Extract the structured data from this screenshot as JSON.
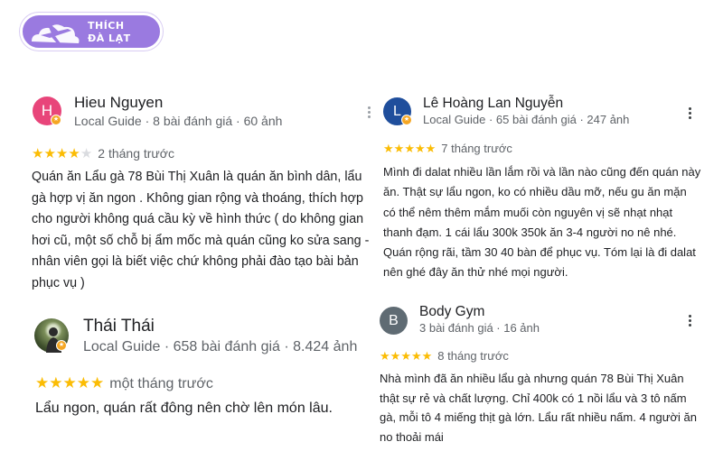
{
  "logo": {
    "line1": "THÍCH",
    "line2": "ĐÀ LẠT"
  },
  "colors": {
    "star": "#fbbc04",
    "badge": "#f5a623",
    "brand": "#9a7ae0"
  },
  "reviews": [
    {
      "name": "Hieu Nguyen",
      "avatar_initial": "H",
      "avatar_color": "#e8457a",
      "meta": "Local Guide · 8 bài đánh giá · 60 ảnh",
      "rating": 4,
      "time": "2 tháng trước",
      "text": "Quán ăn Lẩu gà 78 Bùi Thị Xuân là quán ăn bình dân, lẩu gà hợp vị ăn ngon . Không gian rộng và thoáng, thích hợp cho người không quá cầu kỳ về hình thức ( do không gian hơi cũ, một số chỗ bị ẩm mốc mà quán cũng ko sửa sang - nhân viên gọi là biết việc chứ không phải đào tạo bài bản phục vụ )"
    },
    {
      "name": "Thái Thái",
      "avatar_icon": "profile-photo",
      "meta": "Local Guide · 658 bài đánh giá · 8.424 ảnh",
      "rating": 5,
      "time": "một tháng trước",
      "text": "Lẩu ngon, quán rất đông nên chờ lên món lâu."
    },
    {
      "name": "Lê Hoàng Lan Nguyễn",
      "avatar_initial": "L",
      "avatar_color": "#1f4e9c",
      "meta": "Local Guide · 65 bài đánh giá · 247 ảnh",
      "rating": 5,
      "time": "7 tháng trước",
      "text": "Mình đi dalat nhiều lần lắm rồi và lần nào cũng đến quán này ăn. Thật sự lẩu ngon, ko có nhiều dầu mỡ, nếu gu ăn mặn có thể nêm thêm mắm muối còn nguyên vị sẽ nhạt nhạt thanh đạm. 1 cái lẩu 300k 350k ăn 3-4 người no nê nhé. Quán rộng rãi, tầm 30 40 bàn để phục vụ. Tóm lại là đi dalat nên ghé đây ăn thử nhé mọi người."
    },
    {
      "name": "Body Gym",
      "avatar_initial": "B",
      "avatar_color": "#5f6b73",
      "meta": "3 bài đánh giá · 16 ảnh",
      "rating": 5,
      "time": "8 tháng trước",
      "text": "Nhà mình đã ăn nhiều lẩu gà nhưng quán 78 Bùi Thị Xuân thật sự rẻ và chất lượng. Chỉ 400k có 1 nồi lẩu và 3 tô nấm gà, mỗi tô 4 miếng thịt gà lớn. Lẩu rất nhiều nấm. 4 người ăn no thoải mái"
    }
  ]
}
